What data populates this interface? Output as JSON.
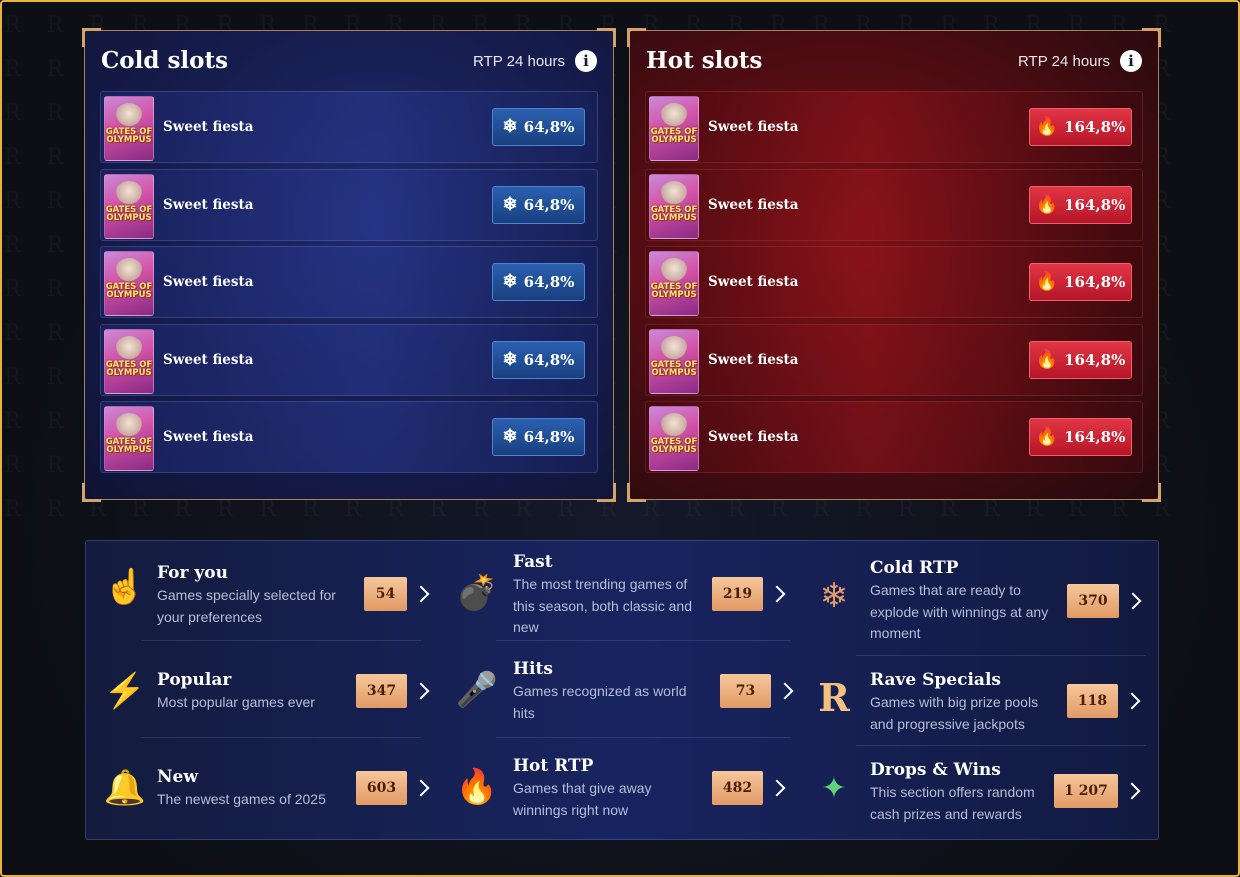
{
  "cold": {
    "title": "Cold slots",
    "rtp_label": "RTP 24 hours",
    "info_glyph": "i",
    "badge_icon": "snowflake-icon",
    "rows": [
      {
        "thumb_text": "GATES OF OLYMPUS",
        "name": "Sweet fiesta",
        "rtp": "64,8%"
      },
      {
        "thumb_text": "GATES OF OLYMPUS",
        "name": "Sweet fiesta",
        "rtp": "64,8%"
      },
      {
        "thumb_text": "GATES OF OLYMPUS",
        "name": "Sweet fiesta",
        "rtp": "64,8%"
      },
      {
        "thumb_text": "GATES OF OLYMPUS",
        "name": "Sweet fiesta",
        "rtp": "64,8%"
      },
      {
        "thumb_text": "GATES OF OLYMPUS",
        "name": "Sweet fiesta",
        "rtp": "64,8%"
      }
    ]
  },
  "hot": {
    "title": "Hot slots",
    "rtp_label": "RTP 24 hours",
    "info_glyph": "i",
    "badge_icon": "fire-icon",
    "rows": [
      {
        "thumb_text": "GATES OF OLYMPUS",
        "name": "Sweet fiesta",
        "rtp": "164,8%"
      },
      {
        "thumb_text": "GATES OF OLYMPUS",
        "name": "Sweet fiesta",
        "rtp": "164,8%"
      },
      {
        "thumb_text": "GATES OF OLYMPUS",
        "name": "Sweet fiesta",
        "rtp": "164,8%"
      },
      {
        "thumb_text": "GATES OF OLYMPUS",
        "name": "Sweet fiesta",
        "rtp": "164,8%"
      },
      {
        "thumb_text": "GATES OF OLYMPUS",
        "name": "Sweet fiesta",
        "rtp": "164,8%"
      }
    ]
  },
  "categories": [
    {
      "title": "For you",
      "desc": "Games specially selected for your preferences",
      "count": "54",
      "icon": "pointing-finger-icon"
    },
    {
      "title": "Fast",
      "desc": "The most trending games of this season, both classic and new",
      "count": "219",
      "icon": "bomb-icon"
    },
    {
      "title": "Cold RTP",
      "desc": "Games that are ready to explode with winnings at any moment",
      "count": "370",
      "icon": "snowflake-icon"
    },
    {
      "title": "Popular",
      "desc": "Most popular games ever",
      "count": "347",
      "icon": "lightning-icon"
    },
    {
      "title": "Hits",
      "desc": "Games recognized as world hits",
      "count": "73",
      "icon": "microphone-icon"
    },
    {
      "title": "Rave Specials",
      "desc": "Games with big prize pools and progressive jackpots",
      "count": "118",
      "icon": "crown-r-icon"
    },
    {
      "title": "New",
      "desc": "The newest games of 2025",
      "count": "603",
      "icon": "bell-icon"
    },
    {
      "title": "Hot RTP",
      "desc": "Games that give away winnings right now",
      "count": "482",
      "icon": "flame-icon"
    },
    {
      "title": "Drops & Wins",
      "desc": "This section offers random cash prizes and rewards",
      "count": "1 207",
      "icon": "drops-wins-icon"
    }
  ],
  "colors": {
    "accent_gold": "#e8b33c",
    "cold_badge": "#1f4d96",
    "hot_badge": "#c61f32",
    "count_badge": "#f0b27c"
  }
}
